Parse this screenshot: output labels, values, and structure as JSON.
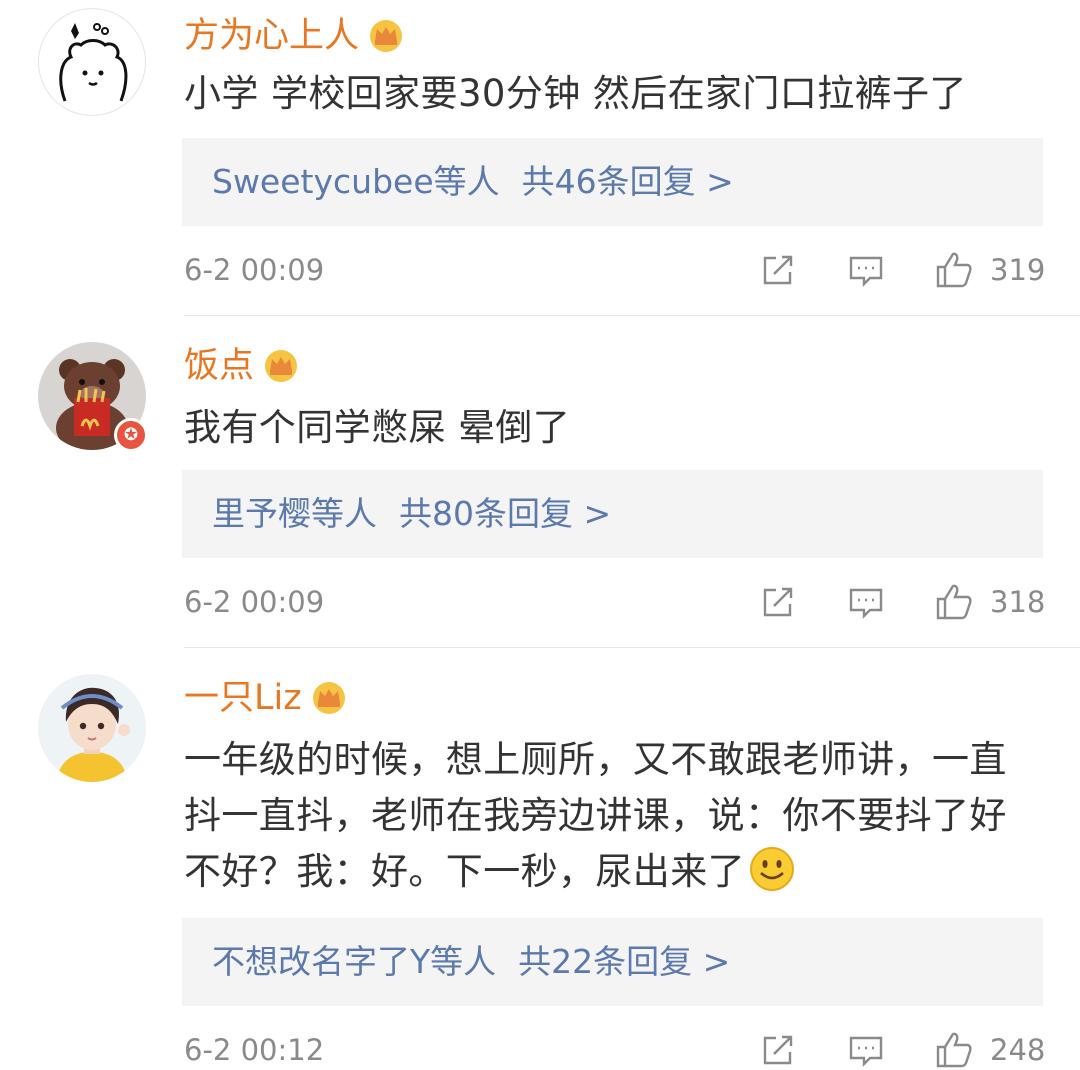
{
  "comments": [
    {
      "username": "方为心上人",
      "text": "小学 学校回家要30分钟 然后在家门口拉裤子了",
      "reply_users": "Sweetycubee等人",
      "reply_count": "共46条回复 >",
      "time": "6-2 00:09",
      "likes": "319",
      "avatar": "bear-doodle-icon"
    },
    {
      "username": "饭点",
      "text": "我有个同学憋屎 晕倒了",
      "reply_users": "里予樱等人",
      "reply_count": "共80条回复 >",
      "time": "6-2 00:09",
      "likes": "318",
      "avatar": "brown-bear-icon"
    },
    {
      "username": "一只Liz",
      "text_lines": [
        "一年级的时候，想上厕所，又不敢跟老师讲，一直",
        "抖一直抖，老师在我旁边讲课，说：你不要抖了好",
        "不好？我：好。下一秒，尿出来了"
      ],
      "reply_users": "不想改名字了Y等人",
      "reply_count": "共22条回复 >",
      "time": "6-2 00:12",
      "likes": "248",
      "avatar": "anime-girl-icon"
    }
  ],
  "colors": {
    "username": "#e87722",
    "reply_link": "#5b79ac",
    "meta": "#8a8a8a",
    "reply_bg": "#f4f4f4",
    "vip_badge": "#e8543f"
  },
  "icons": {
    "crown": "crown-icon",
    "share": "share-icon",
    "comment": "comment-icon",
    "like": "thumbs-up-icon",
    "emoji": "smile-emoji-icon",
    "vip": "vip-star-badge-icon"
  }
}
